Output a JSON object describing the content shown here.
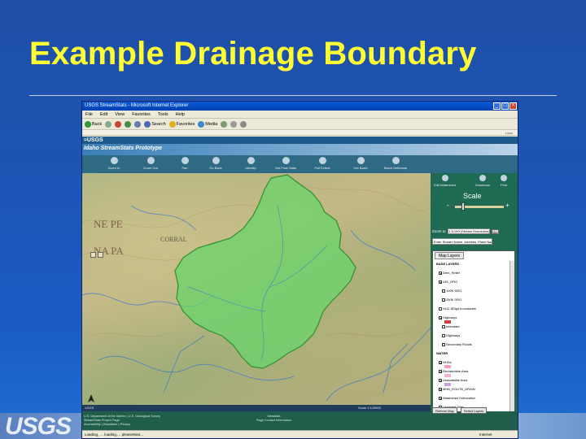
{
  "slide": {
    "title": "Example Drainage Boundary",
    "footer_logo": "USGS"
  },
  "browser": {
    "window_title": "USGS StreamStats - Microsoft Internet Explorer",
    "menu": [
      "File",
      "Edit",
      "View",
      "Favorites",
      "Tools",
      "Help"
    ],
    "toolbar": [
      "Back",
      "Search",
      "Favorites",
      "Media"
    ],
    "address": "Links",
    "status_left": "Loading, … loading,… pleaseWait…",
    "status_zone": "Internet"
  },
  "app": {
    "usgs_header": "≈USGS",
    "title": "Idaho StreamStats Prototype",
    "tools": [
      "Zoom In",
      "Zoom Out",
      "Pan",
      "Go Back",
      "Identify",
      "Get Flow Stats",
      "Full Extent",
      "Get Basin",
      "Batch Delineate",
      "Edit Watershed",
      "Download",
      "Print"
    ],
    "scale_label": "Scale",
    "scale_minus": "-",
    "scale_plus": "+",
    "zoom_label": "Zoom to",
    "zoom_value": "1:5,000 (Stream Resolution)",
    "go_label": "Go",
    "address_field": "Enter Stream Name, Address, Place Name",
    "map_status_left": "USGS",
    "map_status_scale": "Scale 1:125000",
    "map_labels": [
      "NE  PE",
      "NA  PA",
      "CORRAL"
    ],
    "layers_tab": "Map Layers",
    "layers": [
      {
        "label": "BASE LAYERS",
        "kind": "group"
      },
      {
        "label": "Dem_Relief",
        "kind": "item",
        "checked": true
      },
      {
        "label": "24K_DRG",
        "kind": "item",
        "checked": true
      },
      {
        "label": "100K DRG",
        "kind": "sub",
        "checked": false
      },
      {
        "label": "250K DRG",
        "kind": "sub",
        "checked": false
      },
      {
        "label": "HUC 8Digit boundaries",
        "kind": "item",
        "checked": false
      },
      {
        "label": "Highways",
        "kind": "item",
        "checked": true
      },
      {
        "label": "Interstate",
        "kind": "sub",
        "checked": false
      },
      {
        "label": "Highways",
        "kind": "sub",
        "checked": false
      },
      {
        "label": "Secondary Roads",
        "kind": "sub",
        "checked": false
      },
      {
        "label": "WATER",
        "kind": "group"
      },
      {
        "label": "NHDs",
        "kind": "item",
        "checked": true
      },
      {
        "label": "Reclaimable Area",
        "kind": "item",
        "checked": true
      },
      {
        "label": "Unavailable Area",
        "kind": "item",
        "checked": true
      },
      {
        "label": "MHB_ROUTE_DRAIN",
        "kind": "item",
        "checked": true
      },
      {
        "label": "Watershed Delineation",
        "kind": "item",
        "checked": true
      },
      {
        "label": "Ungaged Sites",
        "kind": "item",
        "checked": false
      }
    ],
    "refresh_button": "Refresh Map",
    "select_layers_button": "Select Layers",
    "footer_left": [
      "U.S. Department of the Interior | U.S. Geological Survey",
      "StreamStats Project Page",
      "Accessibility | Disclaimer | Privacy"
    ],
    "footer_mid": [
      "Metadata",
      "Page Contact Information"
    ]
  },
  "colors": {
    "title": "#ffff33",
    "basin_fill": "#6bd36b",
    "basin_stroke": "#2f8f2f"
  }
}
